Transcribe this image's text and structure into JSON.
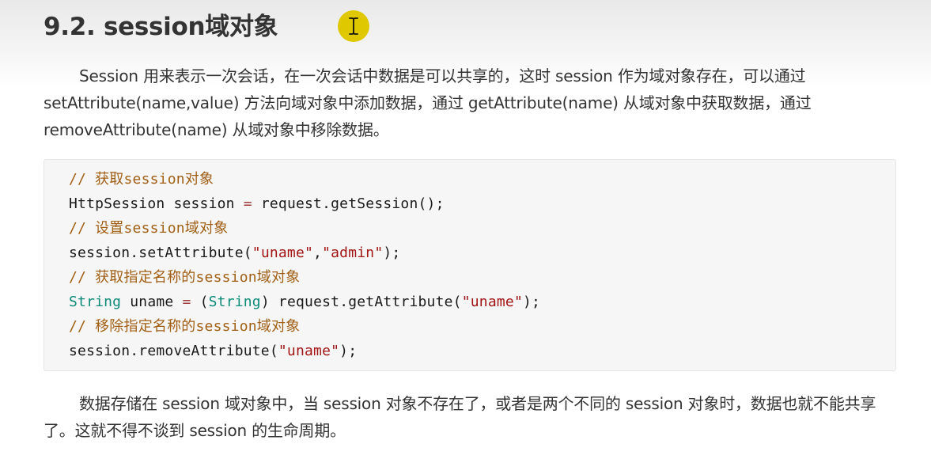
{
  "section": {
    "heading": "9.2. session域对象"
  },
  "paragraphs": {
    "intro": "Session 用来表示一次会话，在一次会话中数据是可以共享的，这时 session 作为域对象存在，可以通过 setAttribute(name,value) 方法向域对象中添加数据，通过 getAttribute(name) 从域对象中获取数据，通过 removeAttribute(name) 从域对象中移除数据。",
    "outro": "数据存储在 session 域对象中，当 session 对象不存在了，或者是两个不同的 session 对象时，数据也就不能共享了。这就不得不谈到 session 的生命周期。"
  },
  "code": {
    "comment1": "// 获取session对象",
    "line1_a": "HttpSession session ",
    "line1_op": "=",
    "line1_b": " request.getSession();",
    "comment2": "// 设置session域对象",
    "line2_a": "session.setAttribute(",
    "line2_s1": "\"uname\"",
    "line2_comma": ",",
    "line2_s2": "\"admin\"",
    "line2_end": ");",
    "comment3": "// 获取指定名称的session域对象",
    "line3_type1": "String",
    "line3_a": " uname ",
    "line3_op": "=",
    "line3_b": " (",
    "line3_type2": "String",
    "line3_c": ") request.getAttribute(",
    "line3_s": "\"uname\"",
    "line3_end": ");",
    "comment4": "// 移除指定名称的session域对象",
    "line4_a": "session.removeAttribute(",
    "line4_s": "\"uname\"",
    "line4_end": ");"
  },
  "cursor": {
    "icon": "text-cursor-icon",
    "highlight_color": "#e0c800"
  }
}
